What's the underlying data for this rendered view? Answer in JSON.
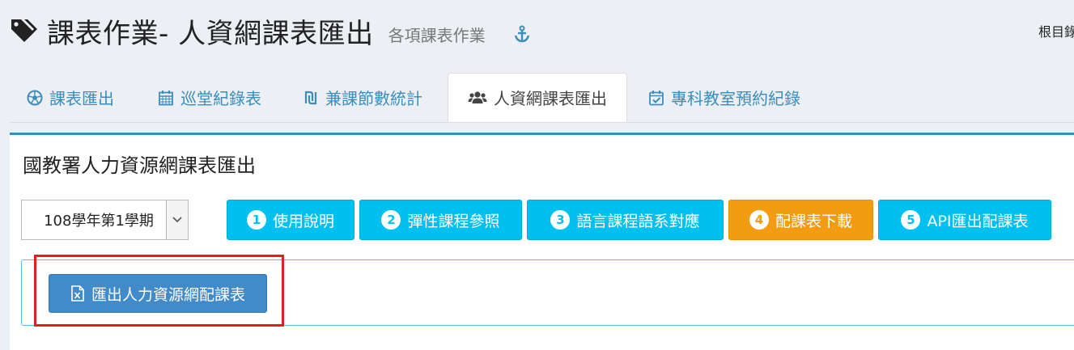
{
  "header": {
    "title": "課表作業- 人資網課表匯出",
    "subtitle": "各項課表作業",
    "icon": "tags-icon",
    "anchor_icon": "anchor-icon",
    "root_label": "根目錄"
  },
  "tabs": [
    {
      "label": "課表匯出",
      "icon": "soccer-ball-icon",
      "active": false
    },
    {
      "label": "巡堂紀錄表",
      "icon": "calendar-grid-icon",
      "active": false
    },
    {
      "label": "兼課節數統計",
      "icon": "currency-icon",
      "active": false
    },
    {
      "label": "人資網課表匯出",
      "icon": "users-icon",
      "active": true
    },
    {
      "label": "專科教室預約紀錄",
      "icon": "calendar-check-icon",
      "active": false
    }
  ],
  "panel": {
    "title": "國教署人力資源網課表匯出",
    "semester": "108學年第1學期",
    "steps": [
      {
        "num": "1",
        "label": "使用說明",
        "style": "info"
      },
      {
        "num": "2",
        "label": "彈性課程參照",
        "style": "info"
      },
      {
        "num": "3",
        "label": "語言課程語系對應",
        "style": "info"
      },
      {
        "num": "4",
        "label": "配課表下載",
        "style": "warning"
      },
      {
        "num": "5",
        "label": "API匯出配課表",
        "style": "info"
      }
    ],
    "export_button": "匯出人力資源網配課表",
    "export_icon": "file-excel-icon"
  },
  "colors": {
    "primary": "#3c8dbc",
    "info": "#00c0ef",
    "warning": "#f39c12",
    "export_button": "#428bca",
    "highlight": "#e02020"
  }
}
